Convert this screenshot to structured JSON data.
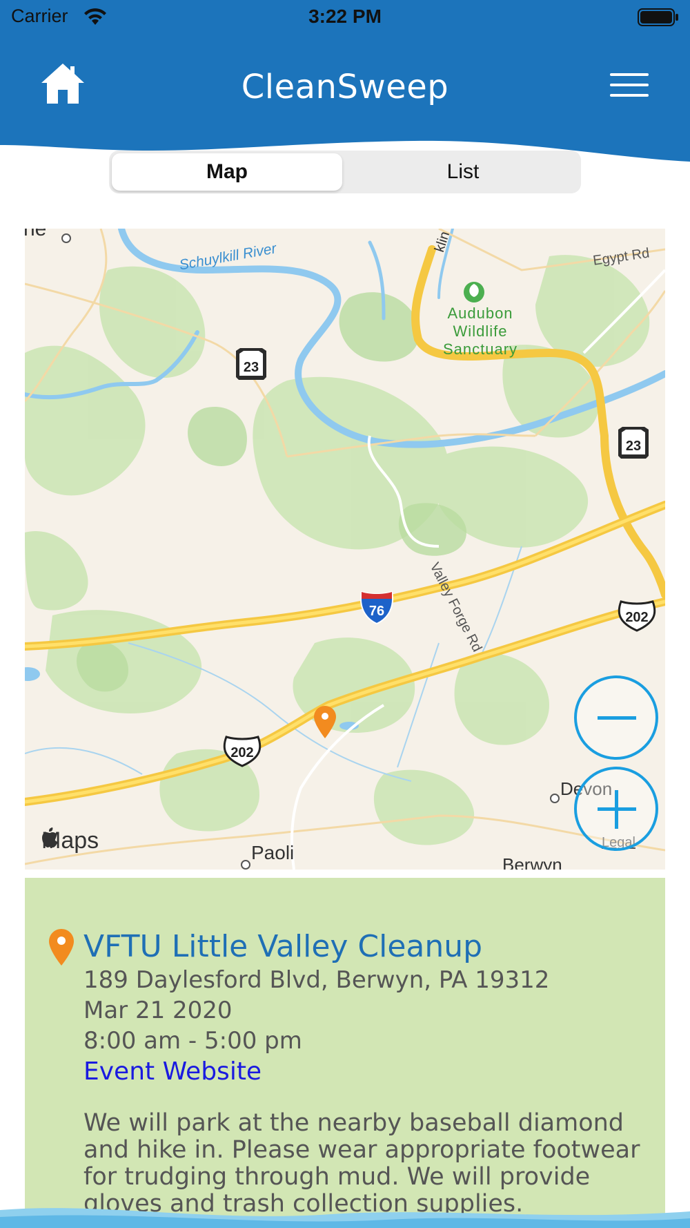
{
  "status_bar": {
    "carrier": "Carrier",
    "time": "3:22 PM"
  },
  "header": {
    "title": "CleanSweep",
    "home_icon": "home-icon",
    "menu_icon": "hamburger-menu-icon",
    "color": "#1c74bb"
  },
  "segmented": {
    "tabs": [
      "Map",
      "List"
    ],
    "selected": "Map"
  },
  "map": {
    "attribution": "Maps",
    "legal": "Legal",
    "places": {
      "river": "Schuylkill River",
      "sanctuary": "Audubon Wildlife Sanctuary",
      "egypt_rd": "Egypt Rd",
      "hwy_fragment": "klin Hwy",
      "valley_forge_rd": "Valley Forge Rd",
      "paoli": "Paoli",
      "devon": "Devon",
      "berwyn": "Berwyn",
      "corner_fragment": "ne"
    },
    "shields": {
      "pa23": "23",
      "i76": "76",
      "us202": "202"
    },
    "zoom_out_icon": "minus-icon",
    "zoom_in_icon": "plus-icon",
    "accent": "#1a9ee0",
    "pin_color": "#f28b1f"
  },
  "event": {
    "title": "VFTU Little Valley Cleanup",
    "address": "189 Daylesford Blvd, Berwyn, PA 19312",
    "date": "Mar 21 2020",
    "time": "8:00 am - 5:00 pm",
    "link_label": "Event Website",
    "description": "We will park at the nearby baseball diamond and hike in. Please wear appropriate footwear for trudging through mud. We will provide gloves and trash collection supplies.",
    "card_color": "#d2e6b4"
  }
}
